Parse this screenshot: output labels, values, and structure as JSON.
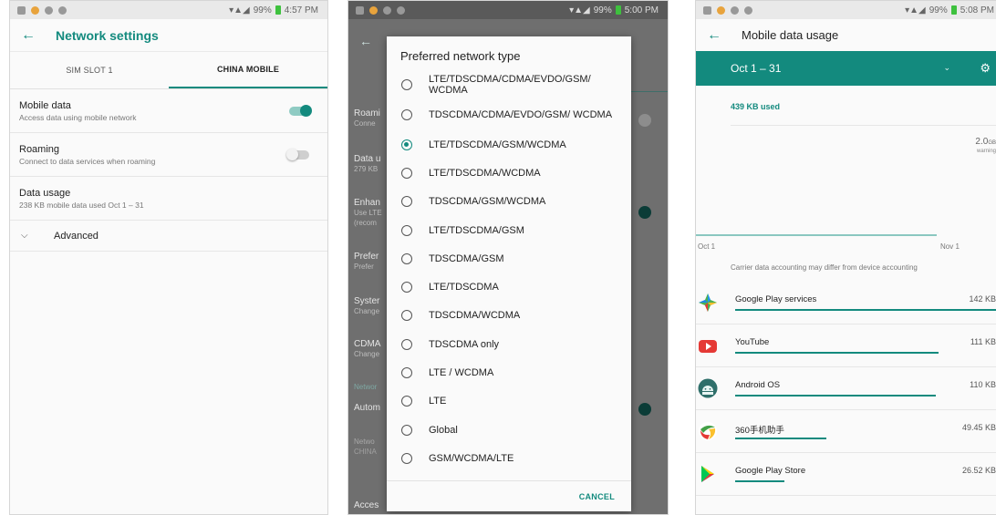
{
  "screen1": {
    "status_time": "4:57 PM",
    "status_battery": "99%",
    "title": "Network settings",
    "tabs": [
      {
        "label": "SIM SLOT 1",
        "active": false
      },
      {
        "label": "CHINA MOBILE",
        "active": true
      }
    ],
    "prefs": [
      {
        "title": "Mobile data",
        "subtitle": "Access data using mobile network",
        "toggle": "on"
      },
      {
        "title": "Roaming",
        "subtitle": "Connect to data services when roaming",
        "toggle": "off"
      },
      {
        "title": "Data usage",
        "subtitle": "238 KB mobile data used Oct 1 – 31",
        "toggle": null
      }
    ],
    "advanced_label": "Advanced",
    "colors": {
      "accent": "#138a7e"
    }
  },
  "screen2": {
    "status_time": "5:00 PM",
    "status_battery": "99%",
    "background_fragments": [
      {
        "title": "Roami",
        "sub": "Conne"
      },
      {
        "title": "Data u",
        "sub": "279 KB"
      },
      {
        "title": "Enhan",
        "sub": "Use LTE"
      },
      {
        "title": "Prefer",
        "sub": "Prefer"
      },
      {
        "title": "Syster",
        "sub": "Change"
      },
      {
        "title": "CDMA",
        "sub": "Change"
      },
      {
        "title": "Networ",
        "sub": ""
      },
      {
        "title": "Autom",
        "sub": ""
      },
      {
        "title": "Netwo",
        "sub": "CHINA"
      },
      {
        "title": "Acces",
        "sub": ""
      }
    ],
    "background_extra": "(recom",
    "dialog": {
      "title": "Preferred network type",
      "options": [
        {
          "label": "LTE/TDSCDMA/CDMA/EVDO/GSM/ WCDMA",
          "selected": false
        },
        {
          "label": "TDSCDMA/CDMA/EVDO/GSM/ WCDMA",
          "selected": false
        },
        {
          "label": "LTE/TDSCDMA/GSM/WCDMA",
          "selected": true
        },
        {
          "label": "LTE/TDSCDMA/WCDMA",
          "selected": false
        },
        {
          "label": "TDSCDMA/GSM/WCDMA",
          "selected": false
        },
        {
          "label": "LTE/TDSCDMA/GSM",
          "selected": false
        },
        {
          "label": "TDSCDMA/GSM",
          "selected": false
        },
        {
          "label": "LTE/TDSCDMA",
          "selected": false
        },
        {
          "label": "TDSCDMA/WCDMA",
          "selected": false
        },
        {
          "label": "TDSCDMA only",
          "selected": false
        },
        {
          "label": "LTE / WCDMA",
          "selected": false
        },
        {
          "label": "LTE",
          "selected": false
        },
        {
          "label": "Global",
          "selected": false
        },
        {
          "label": "GSM/WCDMA/LTE",
          "selected": false
        }
      ],
      "cancel_label": "CANCEL"
    }
  },
  "screen3": {
    "status_time": "5:08 PM",
    "status_battery": "99%",
    "title": "Mobile data usage",
    "cycle_label": "Oct 1 – 31",
    "used_label": "439 KB used",
    "warning_value": "2.0",
    "warning_unit": "GB",
    "warning_label": "warning",
    "x_start": "Oct 1",
    "x_end": "Nov 1",
    "note": "Carrier data accounting may differ from device accounting",
    "apps": [
      {
        "name": "Google Play services",
        "size": "142 KB",
        "usage_fraction": 1.0,
        "icon": "google-play-services-icon"
      },
      {
        "name": "YouTube",
        "size": "111 KB",
        "usage_fraction": 0.78,
        "icon": "youtube-icon"
      },
      {
        "name": "Android OS",
        "size": "110 KB",
        "usage_fraction": 0.77,
        "icon": "android-os-icon"
      },
      {
        "name": "360手机助手",
        "size": "49.45 KB",
        "usage_fraction": 0.35,
        "icon": "360-assistant-icon"
      },
      {
        "name": "Google Play Store",
        "size": "26.52 KB",
        "usage_fraction": 0.19,
        "icon": "google-play-store-icon"
      }
    ]
  }
}
